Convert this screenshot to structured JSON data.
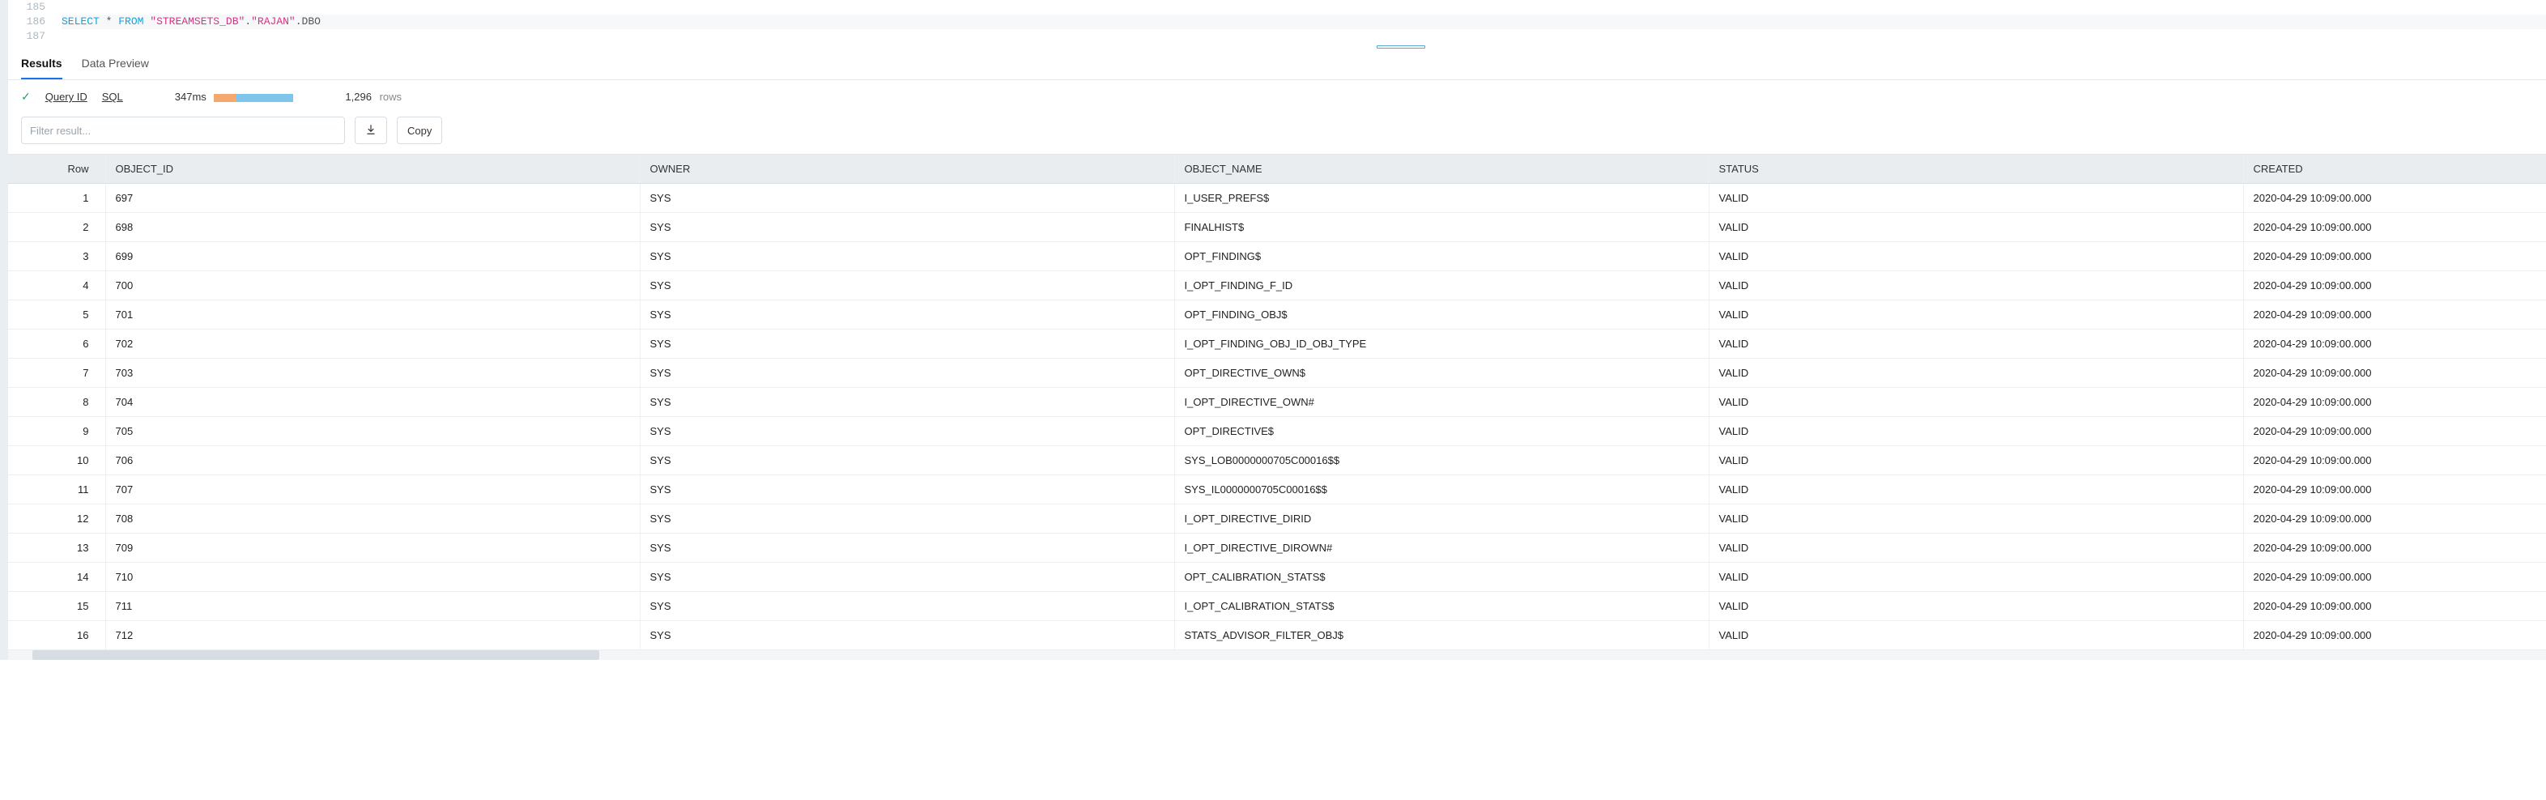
{
  "editor": {
    "lines": [
      "185",
      "186",
      "187"
    ],
    "sql": {
      "select": "SELECT",
      "star": "*",
      "from": "FROM",
      "db": "\"STREAMSETS_DB\"",
      "dot1": ".",
      "schema": "\"RAJAN\"",
      "dot2": ".",
      "table": "DBO"
    }
  },
  "tabs": {
    "results": "Results",
    "dataPreview": "Data Preview"
  },
  "status": {
    "queryId": "Query ID",
    "sql": "SQL",
    "timing": "347ms",
    "rowcount": "1,296",
    "rowsLabel": "rows"
  },
  "controls": {
    "filterPlaceholder": "Filter result...",
    "copy": "Copy"
  },
  "columns": {
    "row": "Row",
    "object_id": "OBJECT_ID",
    "owner": "OWNER",
    "object_name": "OBJECT_NAME",
    "status": "STATUS",
    "created": "CREATED"
  },
  "rows": [
    {
      "n": "1",
      "id": "697",
      "owner": "SYS",
      "name": "I_USER_PREFS$",
      "status": "VALID",
      "created": "2020-04-29 10:09:00.000"
    },
    {
      "n": "2",
      "id": "698",
      "owner": "SYS",
      "name": "FINALHIST$",
      "status": "VALID",
      "created": "2020-04-29 10:09:00.000"
    },
    {
      "n": "3",
      "id": "699",
      "owner": "SYS",
      "name": "OPT_FINDING$",
      "status": "VALID",
      "created": "2020-04-29 10:09:00.000"
    },
    {
      "n": "4",
      "id": "700",
      "owner": "SYS",
      "name": "I_OPT_FINDING_F_ID",
      "status": "VALID",
      "created": "2020-04-29 10:09:00.000"
    },
    {
      "n": "5",
      "id": "701",
      "owner": "SYS",
      "name": "OPT_FINDING_OBJ$",
      "status": "VALID",
      "created": "2020-04-29 10:09:00.000"
    },
    {
      "n": "6",
      "id": "702",
      "owner": "SYS",
      "name": "I_OPT_FINDING_OBJ_ID_OBJ_TYPE",
      "status": "VALID",
      "created": "2020-04-29 10:09:00.000"
    },
    {
      "n": "7",
      "id": "703",
      "owner": "SYS",
      "name": "OPT_DIRECTIVE_OWN$",
      "status": "VALID",
      "created": "2020-04-29 10:09:00.000"
    },
    {
      "n": "8",
      "id": "704",
      "owner": "SYS",
      "name": "I_OPT_DIRECTIVE_OWN#",
      "status": "VALID",
      "created": "2020-04-29 10:09:00.000"
    },
    {
      "n": "9",
      "id": "705",
      "owner": "SYS",
      "name": "OPT_DIRECTIVE$",
      "status": "VALID",
      "created": "2020-04-29 10:09:00.000"
    },
    {
      "n": "10",
      "id": "706",
      "owner": "SYS",
      "name": "SYS_LOB0000000705C00016$$",
      "status": "VALID",
      "created": "2020-04-29 10:09:00.000"
    },
    {
      "n": "11",
      "id": "707",
      "owner": "SYS",
      "name": "SYS_IL0000000705C00016$$",
      "status": "VALID",
      "created": "2020-04-29 10:09:00.000"
    },
    {
      "n": "12",
      "id": "708",
      "owner": "SYS",
      "name": "I_OPT_DIRECTIVE_DIRID",
      "status": "VALID",
      "created": "2020-04-29 10:09:00.000"
    },
    {
      "n": "13",
      "id": "709",
      "owner": "SYS",
      "name": "I_OPT_DIRECTIVE_DIROWN#",
      "status": "VALID",
      "created": "2020-04-29 10:09:00.000"
    },
    {
      "n": "14",
      "id": "710",
      "owner": "SYS",
      "name": "OPT_CALIBRATION_STATS$",
      "status": "VALID",
      "created": "2020-04-29 10:09:00.000"
    },
    {
      "n": "15",
      "id": "711",
      "owner": "SYS",
      "name": "I_OPT_CALIBRATION_STATS$",
      "status": "VALID",
      "created": "2020-04-29 10:09:00.000"
    },
    {
      "n": "16",
      "id": "712",
      "owner": "SYS",
      "name": "STATS_ADVISOR_FILTER_OBJ$",
      "status": "VALID",
      "created": "2020-04-29 10:09:00.000"
    }
  ]
}
